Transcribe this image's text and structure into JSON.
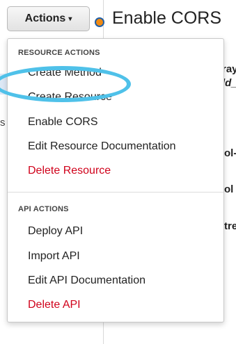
{
  "toolbar": {
    "actions_label": "Actions",
    "actions_caret": "▾"
  },
  "header": {
    "title": "Enable CORS"
  },
  "background_fragments": {
    "left_letter": "s",
    "right_1": "ray",
    "right_2": "ld_",
    "right_3": "ol-",
    "right_4": "ol",
    "right_5": "tre"
  },
  "menu": {
    "resource_header": "RESOURCE ACTIONS",
    "resource_items": [
      {
        "label": "Create Method"
      },
      {
        "label": "Create Resource"
      },
      {
        "label": "Enable CORS"
      },
      {
        "label": "Edit Resource Documentation"
      },
      {
        "label": "Delete Resource"
      }
    ],
    "api_header": "API ACTIONS",
    "api_items": [
      {
        "label": "Deploy API"
      },
      {
        "label": "Import API"
      },
      {
        "label": "Edit API Documentation"
      },
      {
        "label": "Delete API"
      }
    ]
  },
  "colors": {
    "danger": "#d0021b",
    "highlight": "#4fc1e9",
    "accent_dot": "#f08a13"
  }
}
